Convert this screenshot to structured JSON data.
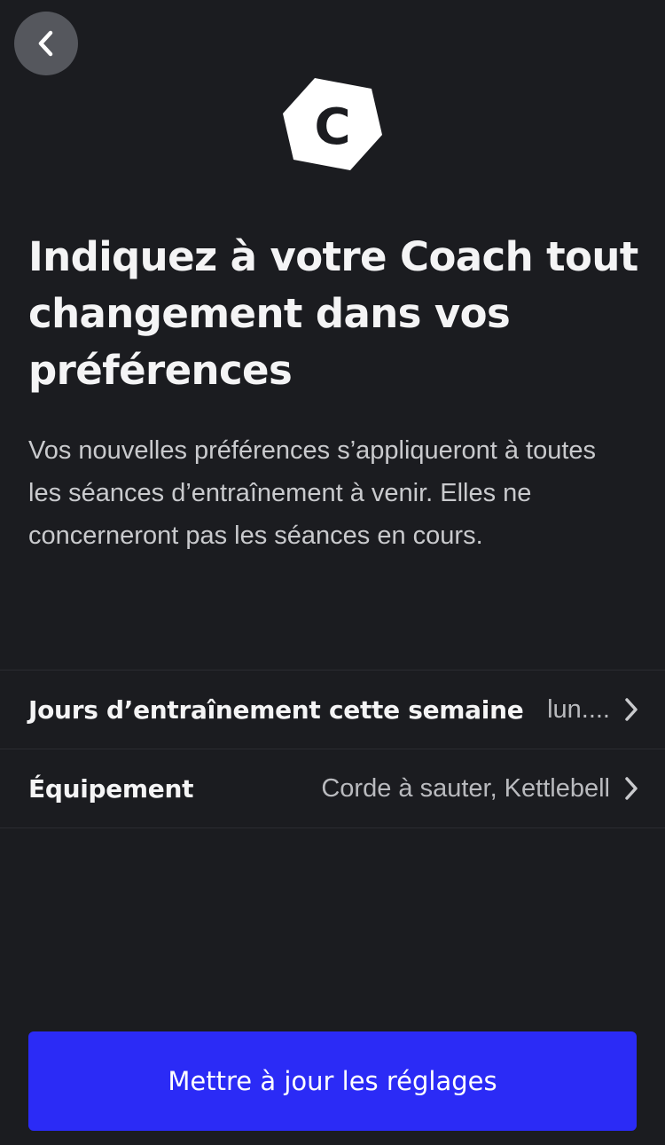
{
  "header": {
    "back_icon": "chevron-left-icon",
    "logo_letter": "C"
  },
  "title": "Indiquez à votre Coach tout changement dans vos préférences",
  "description": "Vos nouvelles préférences s’appliqueront à toutes les séances d’entraînement à venir. Elles ne concerneront pas les séances en cours.",
  "settings": [
    {
      "label": "Jours d’entraînement cette semaine",
      "value": "lun...."
    },
    {
      "label": "Équipement",
      "value": "Corde à sauter, Kettlebell"
    }
  ],
  "cta": {
    "label": "Mettre à jour les réglages"
  },
  "colors": {
    "background": "#1b1c20",
    "accent": "#2b2bf6",
    "back_button": "#55575d",
    "divider": "#2b2c31"
  }
}
